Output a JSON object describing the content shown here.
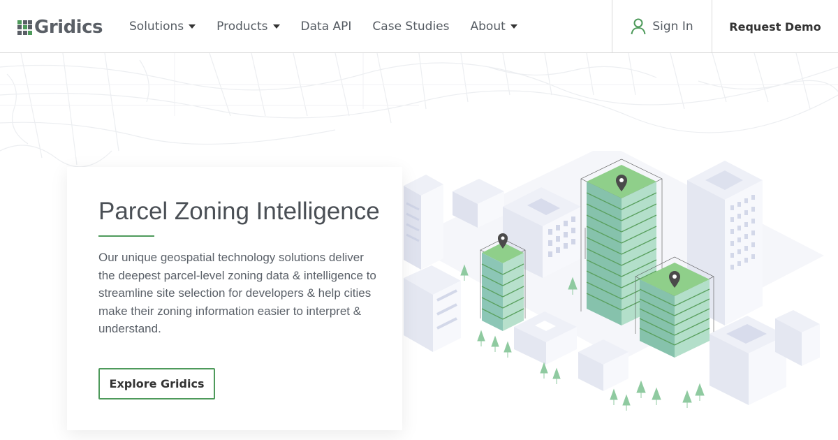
{
  "brand": {
    "name": "Gridics",
    "accent": "#4e9a5b",
    "text_gray": "#5a5f66"
  },
  "nav": {
    "items": [
      {
        "label": "Solutions",
        "dropdown": true
      },
      {
        "label": "Products",
        "dropdown": true
      },
      {
        "label": "Data API",
        "dropdown": false
      },
      {
        "label": "Case Studies",
        "dropdown": false
      },
      {
        "label": "About",
        "dropdown": true
      }
    ],
    "sign_in": {
      "label": "Sign In",
      "icon": "user-icon"
    },
    "request_demo": {
      "label": "Request Demo"
    }
  },
  "hero": {
    "title": "Parcel Zoning Intelligence",
    "description": "Our unique geospatial technology solutions deliver the deepest parcel-level zoning data & intelligence to streamline site selection for developers & help cities make their zoning information easier to interpret & understand.",
    "cta_label": "Explore Gridics",
    "illustration": "isometric-city-buildings"
  }
}
